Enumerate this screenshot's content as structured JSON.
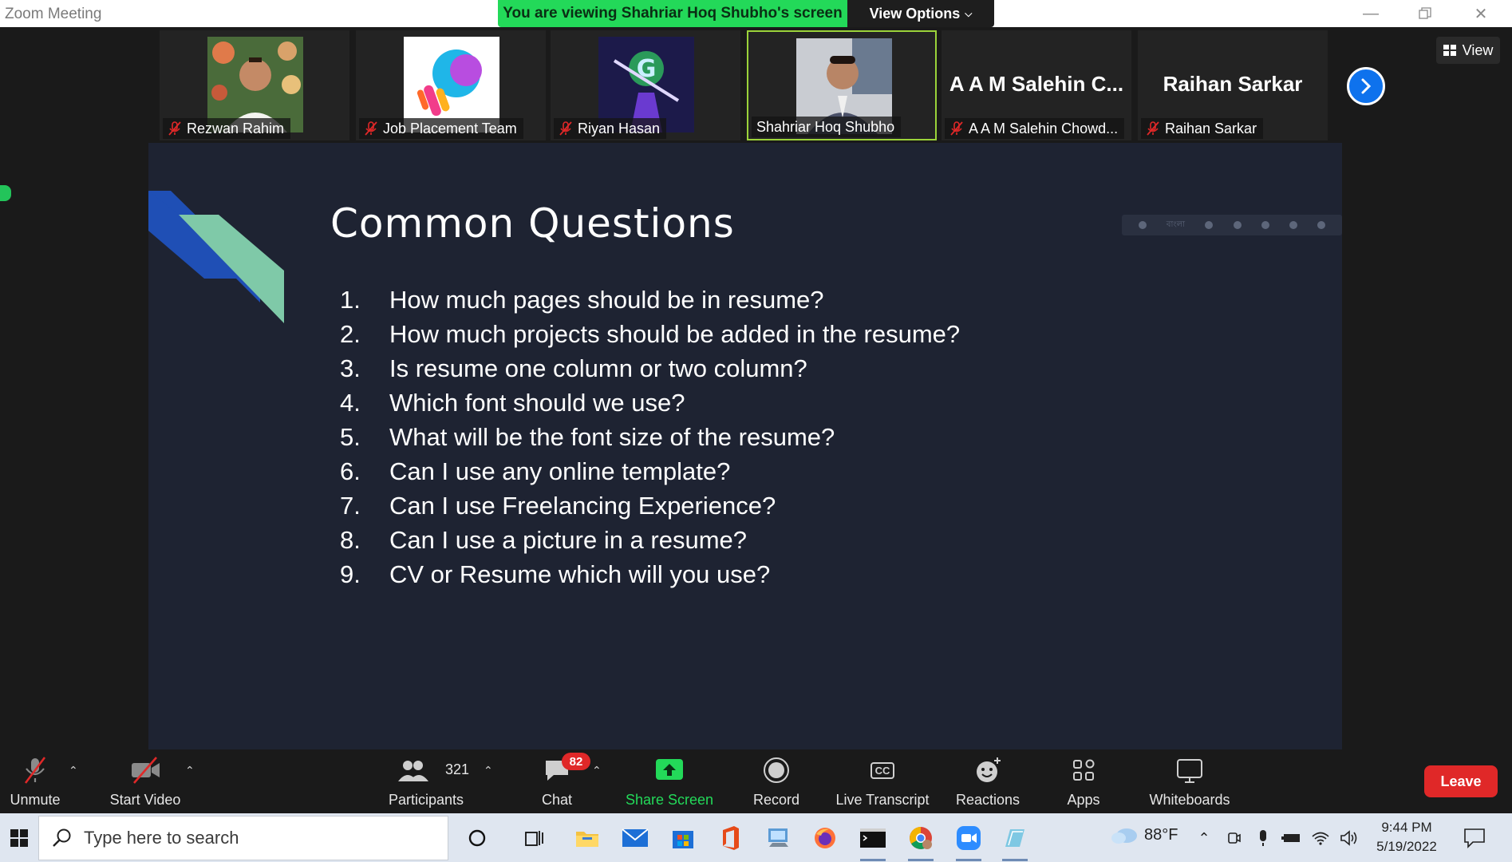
{
  "window": {
    "title": "Zoom Meeting",
    "viewing_banner": "You are viewing Shahriar Hoq Shubho's screen",
    "view_options_label": "View Options"
  },
  "gallery": {
    "tiles": [
      {
        "name": "Rezwan Rahim",
        "muted": true,
        "type": "photo"
      },
      {
        "name": "Job Placement Team",
        "muted": true,
        "type": "logo"
      },
      {
        "name": "Riyan Hasan",
        "muted": true,
        "type": "avatar"
      },
      {
        "name": "Shahriar Hoq Shubho",
        "muted": false,
        "type": "photo",
        "active": true
      },
      {
        "name": "A A M Salehin Chowd...",
        "display_name": "A A M Salehin C...",
        "muted": true,
        "type": "name"
      },
      {
        "name": "Raihan Sarkar",
        "display_name": "Raihan Sarkar",
        "muted": true,
        "type": "name"
      }
    ],
    "view_label": "View"
  },
  "slide": {
    "title": "Common Questions",
    "questions": [
      {
        "num": "1.",
        "text": "How much pages should be in resume?"
      },
      {
        "num": "2.",
        "text": "How much projects should be added in the resume?"
      },
      {
        "num": "3.",
        "text": "Is resume one column or two column?"
      },
      {
        "num": "4.",
        "text": "Which font should  we use?"
      },
      {
        "num": "5.",
        "text": "What will be the font size of the resume?"
      },
      {
        "num": "6.",
        "text": "Can I use any online template?"
      },
      {
        "num": "7.",
        "text": "Can I use Freelancing Experience?"
      },
      {
        "num": "8.",
        "text": "Can I use a picture in a resume?"
      },
      {
        "num": "9.",
        "text": "CV or Resume which will you use?"
      }
    ],
    "toolbar_text": "বাংলা"
  },
  "toolbar": {
    "unmute": "Unmute",
    "start_video": "Start Video",
    "participants": "Participants",
    "participants_count": "321",
    "chat": "Chat",
    "chat_badge": "82",
    "share_screen": "Share Screen",
    "record": "Record",
    "live_transcript": "Live Transcript",
    "cc_label": "CC",
    "reactions": "Reactions",
    "apps": "Apps",
    "whiteboards": "Whiteboards",
    "leave": "Leave"
  },
  "taskbar": {
    "search_placeholder": "Type here to search",
    "weather_temp": "88°F",
    "time": "9:44 PM",
    "date": "5/19/2022"
  },
  "colors": {
    "banner_green": "#23d959",
    "share_green": "#23d959",
    "leave_red": "#e02828",
    "slide_bg": "#1e2332",
    "active_border": "#9bd33a",
    "zoom_blue": "#0e72ed"
  }
}
